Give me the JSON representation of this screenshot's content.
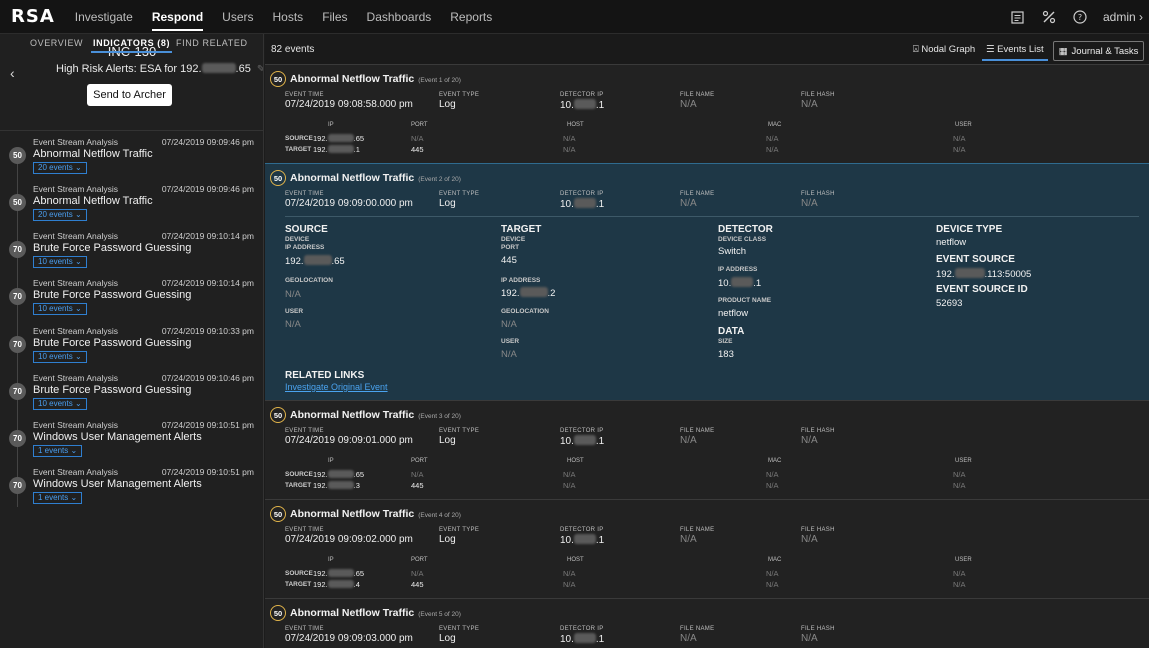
{
  "topnav": {
    "logo": "RSA",
    "tabs": [
      {
        "label": "Investigate",
        "active": false
      },
      {
        "label": "Respond",
        "active": true
      },
      {
        "label": "Users",
        "active": false
      },
      {
        "label": "Hosts",
        "active": false
      },
      {
        "label": "Files",
        "active": false
      },
      {
        "label": "Dashboards",
        "active": false
      },
      {
        "label": "Reports",
        "active": false
      }
    ],
    "user": "admin"
  },
  "incident": {
    "id": "INC-130",
    "title_prefix": "High Risk Alerts: ESA for 192.",
    "title_suffix": ".65",
    "send_button": "Send to Archer",
    "tabs": [
      "OVERVIEW",
      "INDICATORS (8)",
      "FIND RELATED"
    ]
  },
  "indicators": [
    {
      "source": "Event Stream Analysis",
      "time": "07/24/2019 09:09:46 pm",
      "title": "Abnormal Netflow Traffic",
      "score": "50",
      "events": "20 events"
    },
    {
      "source": "Event Stream Analysis",
      "time": "07/24/2019 09:09:46 pm",
      "title": "Abnormal Netflow Traffic",
      "score": "50",
      "events": "20 events"
    },
    {
      "source": "Event Stream Analysis",
      "time": "07/24/2019 09:10:14 pm",
      "title": "Brute Force Password Guessing",
      "score": "70",
      "events": "10 events"
    },
    {
      "source": "Event Stream Analysis",
      "time": "07/24/2019 09:10:14 pm",
      "title": "Brute Force Password Guessing",
      "score": "70",
      "events": "10 events"
    },
    {
      "source": "Event Stream Analysis",
      "time": "07/24/2019 09:10:33 pm",
      "title": "Brute Force Password Guessing",
      "score": "70",
      "events": "10 events"
    },
    {
      "source": "Event Stream Analysis",
      "time": "07/24/2019 09:10:46 pm",
      "title": "Brute Force Password Guessing",
      "score": "70",
      "events": "10 events"
    },
    {
      "source": "Event Stream Analysis",
      "time": "07/24/2019 09:10:51 pm",
      "title": "Windows User Management Alerts",
      "score": "70",
      "events": "1 events"
    },
    {
      "source": "Event Stream Analysis",
      "time": "07/24/2019 09:10:51 pm",
      "title": "Windows User Management Alerts",
      "score": "70",
      "events": "1 events"
    }
  ],
  "main": {
    "event_count": "82 events",
    "views": [
      "Nodal Graph",
      "Events List"
    ],
    "journal_button": "Journal & Tasks"
  },
  "labels": {
    "event_time": "EVENT TIME",
    "event_type": "EVENT TYPE",
    "detector_ip": "DETECTOR IP",
    "file_name": "FILE NAME",
    "file_hash": "FILE HASH",
    "ip": "IP",
    "port": "PORT",
    "host": "HOST",
    "mac": "MAC",
    "user": "USER",
    "source": "SOURCE",
    "target": "TARGET",
    "na": "N/A"
  },
  "events": [
    {
      "title": "Abnormal Netflow Traffic",
      "sub": "(Event 1 of 20)",
      "score": "50",
      "time": "07/24/2019 09:08:58.000 pm",
      "type": "Log",
      "det_prefix": "10.",
      "det_suffix": ".1",
      "src_ip_prefix": "192.",
      "src_ip_suffix": ".65",
      "src_port": "N/A",
      "tgt_ip_prefix": "192.",
      "tgt_ip_suffix": ".1",
      "tgt_port": "445"
    },
    {
      "title": "Abnormal Netflow Traffic",
      "sub": "(Event 2 of 20)",
      "score": "50",
      "time": "07/24/2019 09:09:00.000 pm",
      "type": "Log",
      "det_prefix": "10.",
      "det_suffix": ".1"
    },
    {
      "title": "Abnormal Netflow Traffic",
      "sub": "(Event 3 of 20)",
      "score": "50",
      "time": "07/24/2019 09:09:01.000 pm",
      "type": "Log",
      "det_prefix": "10.",
      "det_suffix": ".1",
      "src_ip_prefix": "192.",
      "src_ip_suffix": ".65",
      "src_port": "N/A",
      "tgt_ip_prefix": "192.",
      "tgt_ip_suffix": ".3",
      "tgt_port": "445"
    },
    {
      "title": "Abnormal Netflow Traffic",
      "sub": "(Event 4 of 20)",
      "score": "50",
      "time": "07/24/2019 09:09:02.000 pm",
      "type": "Log",
      "det_prefix": "10.",
      "det_suffix": ".1",
      "src_ip_prefix": "192.",
      "src_ip_suffix": ".65",
      "src_port": "N/A",
      "tgt_ip_prefix": "192.",
      "tgt_ip_suffix": ".4",
      "tgt_port": "445"
    },
    {
      "title": "Abnormal Netflow Traffic",
      "sub": "(Event 5 of 20)",
      "score": "50",
      "time": "07/24/2019 09:09:03.000 pm",
      "type": "Log",
      "det_prefix": "10.",
      "det_suffix": ".1"
    }
  ],
  "expanded": {
    "source": {
      "title": "SOURCE",
      "device": "DEVICE",
      "ip_label": "IP ADDRESS",
      "ip_prefix": "192.",
      "ip_suffix": ".65",
      "geo_label": "GEOLOCATION",
      "geo": "N/A",
      "user_label": "USER",
      "user": "N/A"
    },
    "target": {
      "title": "TARGET",
      "device": "DEVICE",
      "port_label": "PORT",
      "port": "445",
      "ip_label": "IP ADDRESS",
      "ip_prefix": "192.",
      "ip_suffix": ".2",
      "geo_label": "GEOLOCATION",
      "geo": "N/A",
      "user_label": "USER",
      "user": "N/A"
    },
    "detector": {
      "title": "DETECTOR",
      "class_label": "DEVICE CLASS",
      "class": "Switch",
      "ip_label": "IP ADDRESS",
      "ip_prefix": "10.",
      "ip_suffix": ".1",
      "product_label": "PRODUCT NAME",
      "product": "netflow",
      "data_title": "DATA",
      "size_label": "SIZE",
      "size": "183"
    },
    "device_type": {
      "title": "DEVICE TYPE",
      "value": "netflow",
      "es_title": "EVENT SOURCE",
      "es_prefix": "192.",
      "es_suffix": ".113:50005",
      "esid_title": "EVENT SOURCE ID",
      "esid": "52693"
    },
    "related_title": "RELATED LINKS",
    "related_link": "Investigate Original Event"
  }
}
